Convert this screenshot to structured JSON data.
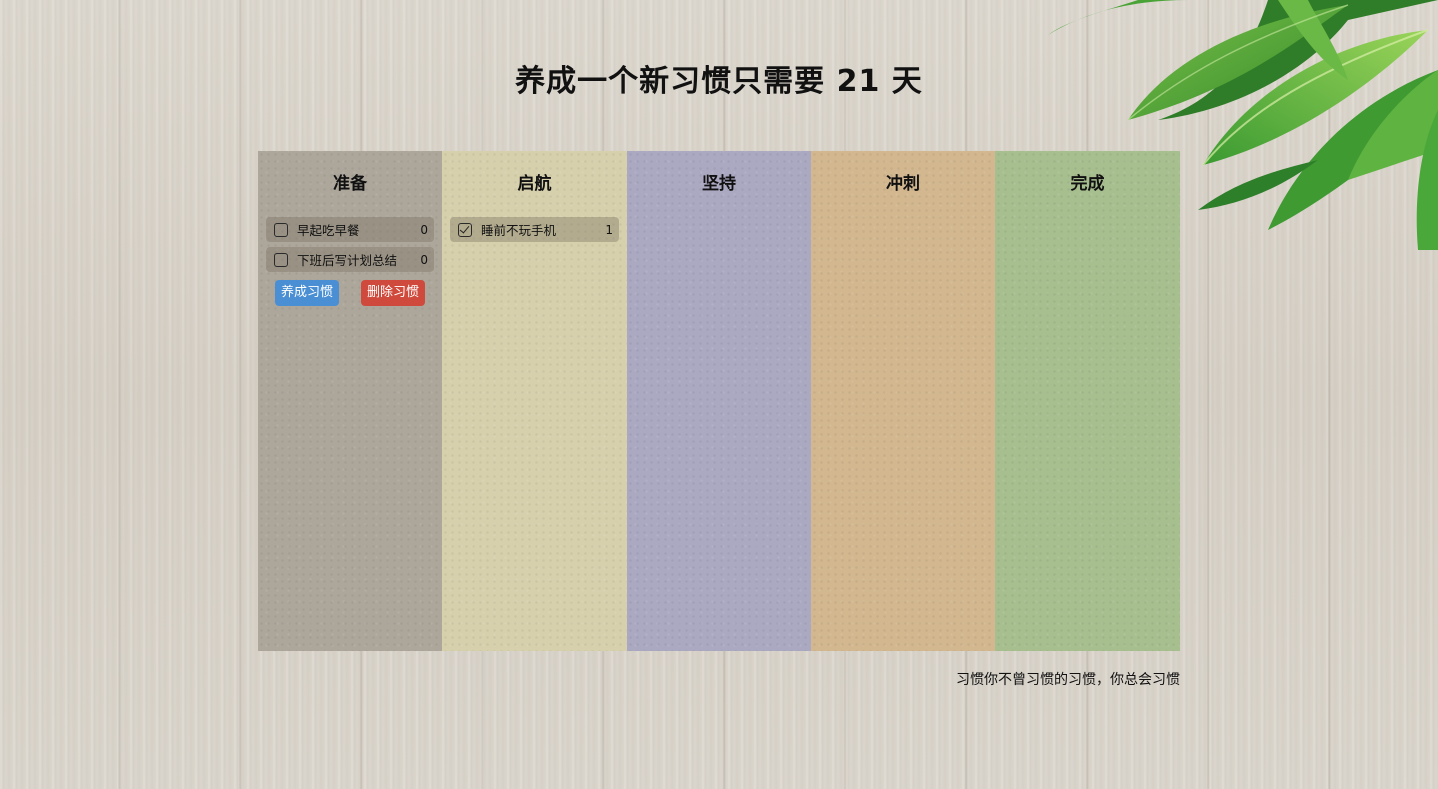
{
  "title": "养成一个新习惯只需要 21 天",
  "colors": {
    "prepare": "#aca69b",
    "launch": "#d6d0ac",
    "persist": "#aba8c2",
    "sprint": "#d2b78f",
    "done": "#a7be8f",
    "add_button": "#4a8fd3",
    "delete_button": "#cf4a3c"
  },
  "columns": [
    {
      "title": "准备",
      "items": [
        {
          "name": "早起吃早餐",
          "count": "0",
          "checked": false
        },
        {
          "name": "下班后写计划总结",
          "count": "0",
          "checked": false
        }
      ]
    },
    {
      "title": "启航",
      "items": [
        {
          "name": "睡前不玩手机",
          "count": "1",
          "checked": true
        }
      ]
    },
    {
      "title": "坚持",
      "items": []
    },
    {
      "title": "冲刺",
      "items": []
    },
    {
      "title": "完成",
      "items": []
    }
  ],
  "actions": {
    "add_label": "养成习惯",
    "delete_label": "删除习惯"
  },
  "footer": {
    "quote": "习惯你不曾习惯的习惯，你总会习惯"
  }
}
